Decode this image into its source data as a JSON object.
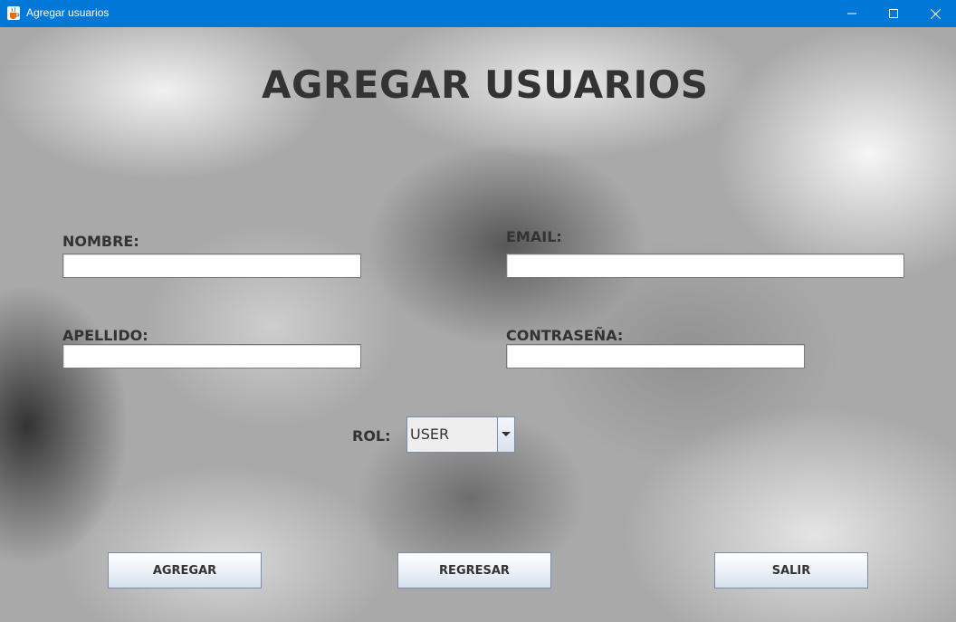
{
  "window": {
    "title": "Agregar usuarios",
    "accent_color": "#0078d7",
    "icon": "java-cup-icon",
    "controls": [
      "minimize-icon",
      "maximize-icon",
      "close-icon"
    ]
  },
  "form": {
    "heading": "AGREGAR USUARIOS",
    "nombre": {
      "label": "NOMBRE:",
      "value": ""
    },
    "email": {
      "label": "EMAIL:",
      "value": ""
    },
    "apellido": {
      "label": "APELLIDO:",
      "value": ""
    },
    "contrasena": {
      "label": "CONTRASEÑA:",
      "value": ""
    },
    "rol": {
      "label": "ROL:",
      "selected": "USER"
    }
  },
  "buttons": {
    "agregar": "AGREGAR",
    "regresar": "REGRESAR",
    "salir": "SALIR"
  }
}
